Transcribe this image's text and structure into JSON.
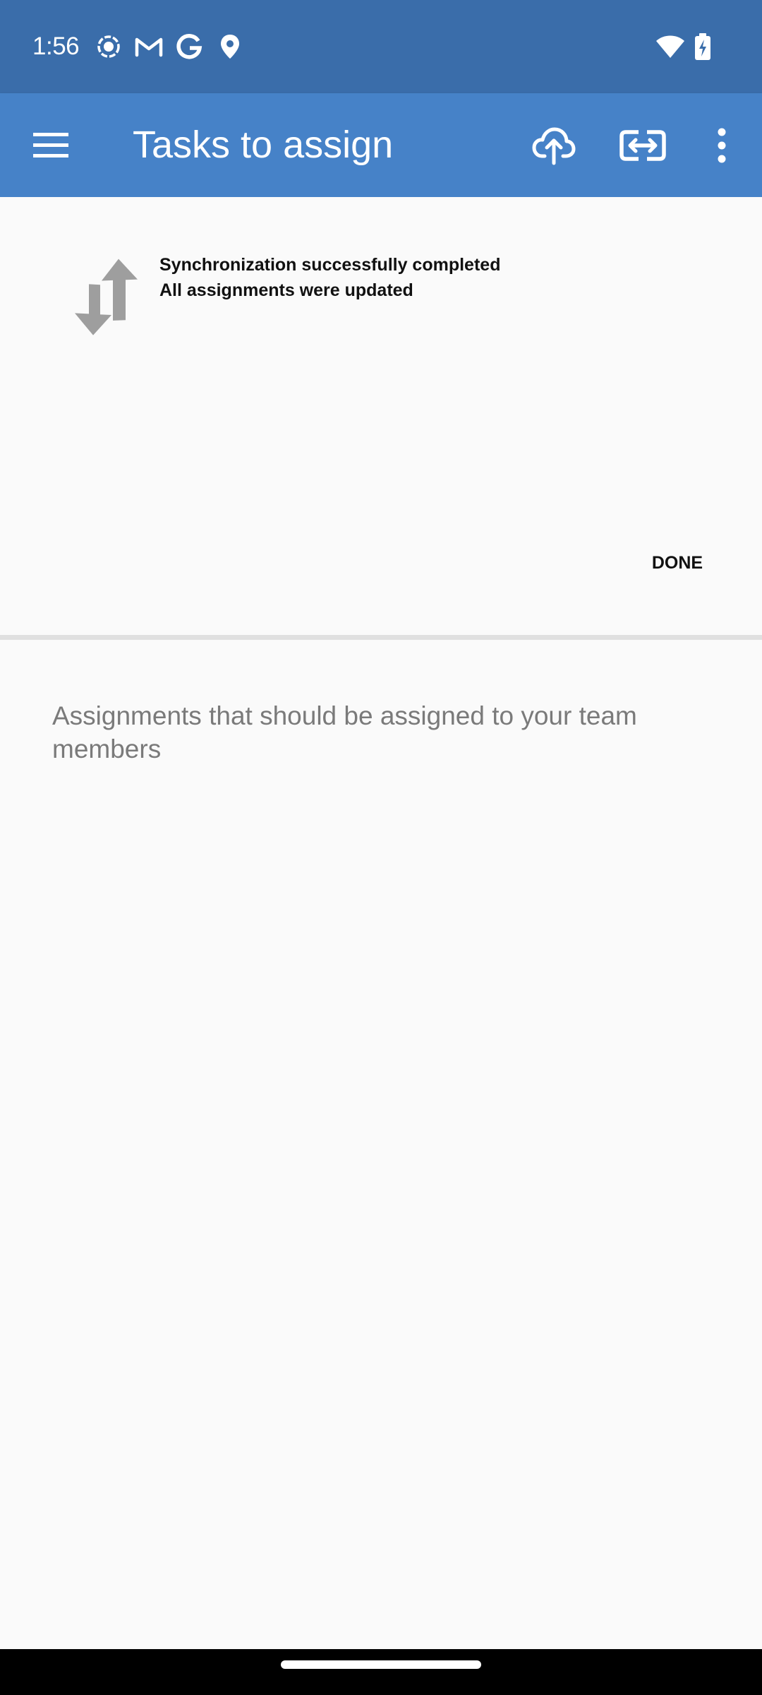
{
  "status_bar": {
    "time": "1:56",
    "left_icons": [
      "screen-record-icon",
      "gmail-icon",
      "google-icon",
      "location-icon"
    ],
    "right_icons": [
      "wifi-icon",
      "battery-charging-icon"
    ]
  },
  "app_bar": {
    "title": "Tasks to assign",
    "icons": [
      "menu-icon",
      "cloud-sync-icon",
      "link-icon",
      "more-options-icon"
    ]
  },
  "sync_panel": {
    "icon": "sync-arrows-icon",
    "line1": "Synchronization successfully completed",
    "line2": "All assignments were updated",
    "done_label": "DONE"
  },
  "content": {
    "description": "Assignments that should be assigned to your team members"
  },
  "colors": {
    "status_bar": "#3a6daa",
    "app_bar": "#4682c8",
    "background": "#fafafa",
    "divider": "#e0e0e0",
    "description_text": "#7a7a7a",
    "sync_icon": "#9e9e9e"
  }
}
